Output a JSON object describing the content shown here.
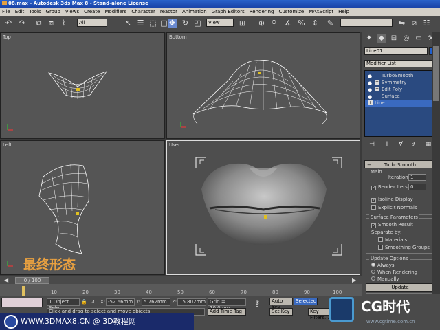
{
  "titlebar": {
    "title": "08.max - Autodesk 3ds Max 8 - Stand-alone License"
  },
  "menu": [
    "File",
    "Edit",
    "Tools",
    "Group",
    "Views",
    "Create",
    "Modifiers",
    "Character",
    "reactor",
    "Animation",
    "Graph Editors",
    "Rendering",
    "Customize",
    "MAXScript",
    "Help"
  ],
  "toolbar": {
    "filter_value": "All",
    "refcoord_value": "View"
  },
  "viewports": {
    "top": "Top",
    "bottom": "Bottom",
    "left": "Left",
    "user": "User"
  },
  "overlay_text": "最终形态",
  "command_panel": {
    "object_name": "Line01",
    "modifier_list": "Modifier List",
    "stack": [
      "TurboSmooth",
      "Symmetry",
      "Edit Poly",
      "Surface",
      "Line"
    ],
    "rollout_title": "TurboSmooth",
    "main_label": "Main",
    "iterations_label": "Iterations:",
    "iterations_value": "1",
    "render_iters_label": "Render Iters:",
    "render_iters_value": "0",
    "isoline_label": "Isoline Display",
    "explicit_normals_label": "Explicit Normals",
    "surface_params_label": "Surface Parameters",
    "smooth_result_label": "Smooth Result",
    "separate_by_label": "Separate by:",
    "materials_label": "Materials",
    "smoothing_groups_label": "Smoothing Groups",
    "update_options_label": "Update Options",
    "always_label": "Always",
    "when_rendering_label": "When Rendering",
    "manually_label": "Manually",
    "update_button": "Update"
  },
  "timeline": {
    "slider_label": "0 / 100",
    "ticks": [
      "10",
      "20",
      "30",
      "40",
      "50",
      "60",
      "70",
      "80",
      "90",
      "100"
    ]
  },
  "statusbar": {
    "selection": "1 Object Sele",
    "x_label": "X:",
    "x_value": "-52.66mm",
    "y_label": "Y:",
    "y_value": "5.762mm",
    "z_label": "Z:",
    "z_value": "15.802mm",
    "grid": "Grid = 10.0mm",
    "autokey_label": "Auto Key",
    "autokey_value": "Selected",
    "setkey_label": "Set Key",
    "prompt": "Click and drag to select and move objects",
    "add_time_tag": "Add Time Tag",
    "key_filters": "Key Filters..."
  },
  "watermark": {
    "text": "WWW.3DMAX8.CN @ 3D教程网"
  },
  "cg_logo": {
    "text": "CG时代",
    "url": "www.cgtime.com.cn"
  }
}
